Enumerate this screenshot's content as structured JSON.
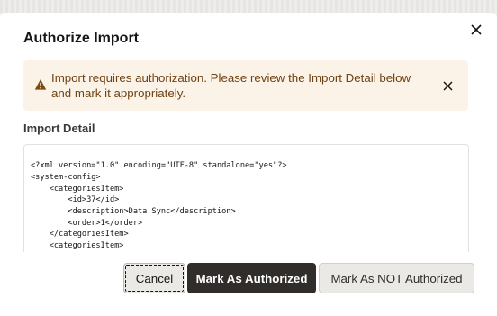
{
  "dialog": {
    "title": "Authorize Import",
    "close_icon": "close-icon"
  },
  "banner": {
    "icon": "warning-icon",
    "message": "Import requires authorization. Please review the Import Detail below and mark it appropriately.",
    "close_icon": "close-icon",
    "text_color": "#6f4213",
    "background": "#fcf3e8"
  },
  "import_detail": {
    "label": "Import Detail",
    "lines": [
      "<?xml version=\"1.0\" encoding=\"UTF-8\" standalone=\"yes\"?>",
      "<system-config>",
      "    <categoriesItem>",
      "        <id>37</id>",
      "        <description>Data Sync</description>",
      "        <order>1</order>",
      "    </categoriesItem>",
      "    <categoriesItem>"
    ]
  },
  "buttons": {
    "cancel": "Cancel",
    "mark_authorized": "Mark As Authorized",
    "mark_not_authorized": "Mark As NOT Authorized"
  },
  "colors": {
    "primary_button": "#312d2a",
    "secondary_button": "#ebe9e6"
  }
}
